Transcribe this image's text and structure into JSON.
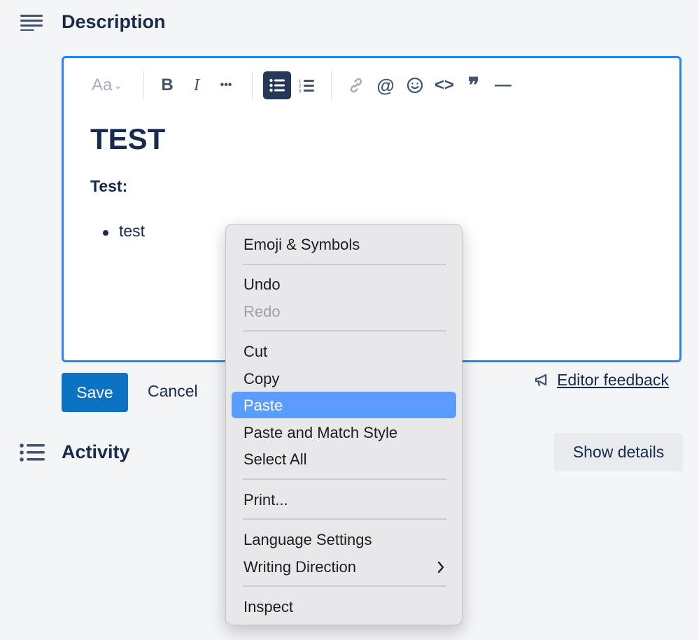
{
  "description": {
    "title": "Description",
    "icon": "lines-icon"
  },
  "toolbar": {
    "text_style": "Aa",
    "items": [
      "bold-icon",
      "italic-icon",
      "more-icon",
      "bullet-list-icon",
      "numbered-list-icon",
      "link-icon",
      "mention-icon",
      "emoji-icon",
      "code-icon",
      "quote-icon",
      "divider-icon"
    ],
    "bold": "B",
    "italic": "I",
    "more": "•••",
    "mention": "@",
    "code": "<>",
    "quote": "❞",
    "divider": "—"
  },
  "content": {
    "heading": "TEST",
    "bold_line": "Test:",
    "bullets": [
      "test"
    ]
  },
  "actions": {
    "save": "Save",
    "cancel": "Cancel",
    "feedback": "Editor feedback"
  },
  "activity": {
    "title": "Activity",
    "show_details": "Show details"
  },
  "context_menu": {
    "items": [
      {
        "label": "Emoji & Symbols"
      },
      {
        "label": "Undo"
      },
      {
        "label": "Redo",
        "disabled": true
      },
      {
        "label": "Cut"
      },
      {
        "label": "Copy"
      },
      {
        "label": "Paste",
        "highlighted": true
      },
      {
        "label": "Paste and Match Style"
      },
      {
        "label": "Select All"
      },
      {
        "label": "Print..."
      },
      {
        "label": "Language Settings"
      },
      {
        "label": "Writing Direction",
        "submenu": true
      },
      {
        "label": "Inspect"
      }
    ]
  },
  "colors": {
    "accent": "#2684ff",
    "primary_button": "#0c73c2",
    "menu_highlight": "#5a9cff",
    "text": "#172b4d"
  }
}
